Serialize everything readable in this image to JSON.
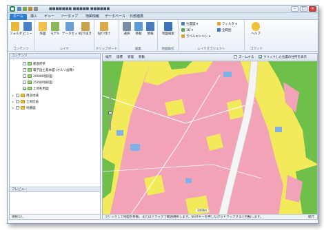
{
  "window": {
    "title": "■■■■■■■ ■■■■■ ■■■■■■"
  },
  "colors": {
    "accent": "#2f7fd1",
    "map_pink": "#f2a3b8",
    "map_yellow": "#f3ea5b",
    "map_green": "#6fbf4b",
    "map_blue": "#7fb3e8",
    "river": "#f4f4f4"
  },
  "tabs": [
    "ホーム",
    "挿入",
    "ビュー",
    "ツータップ",
    "地図情報",
    "データベース",
    "外部連携"
  ],
  "ribbon": {
    "groups": [
      {
        "label": "コンテンツ",
        "buttons": [
          "フォルダ",
          "ビュー"
        ]
      },
      {
        "label": "レイヤ",
        "buttons": [
          "作図",
          "モデル",
          "データセット",
          "切り抜き"
        ]
      },
      {
        "label": "クリップボード",
        "buttons": [
          "貼り付け"
        ]
      },
      {
        "label": "編集",
        "buttons": [
          "選択",
          "移動",
          "情報"
        ]
      },
      {
        "label": "地図操作",
        "buttons": [
          "地図検索"
        ]
      },
      {
        "label": "レイヤオブジェクト",
        "small": [
          "位置図 ▾",
          "3D ▾",
          "ラベルエンジン ▾",
          "フィルタ ▾",
          "全範囲"
        ]
      },
      {
        "label": "コマンド",
        "buttons": [
          "ヘルプ"
        ]
      }
    ]
  },
  "left_panel": {
    "header": "コンテンツ",
    "items": [
      {
        "label": "都道府県",
        "checked": false,
        "type": "layer"
      },
      {
        "label": "電子国土基本図 (オルソ画像)",
        "checked": false,
        "type": "layer"
      },
      {
        "label": "20000地形図",
        "checked": false,
        "type": "layer"
      },
      {
        "label": "25000地形図",
        "checked": false,
        "type": "layer"
      },
      {
        "label": "土地利用図",
        "checked": true,
        "type": "layer"
      },
      {
        "label": "用途地域",
        "checked": false,
        "type": "folder"
      },
      {
        "label": "土地区画",
        "checked": false,
        "type": "folder"
      },
      {
        "label": "地番図",
        "checked": false,
        "type": "folder"
      }
    ],
    "preview_header": "プレビュー",
    "status": "選択なし"
  },
  "map": {
    "toolbar": {
      "items": [
        "縮尺",
        "座標",
        "管理",
        "移動"
      ],
      "zoom_check_label": "ズームする",
      "click_check_label": "クリックした位置の住所を表示"
    },
    "scale_text": "1000m",
    "zoom_level": 0.35,
    "status_text": "クリックして地図を移動。またはドラッグで範囲選択します。Shiftキーを押しながらドラッグすると回転します。",
    "zoom_pct": "縮尺"
  }
}
